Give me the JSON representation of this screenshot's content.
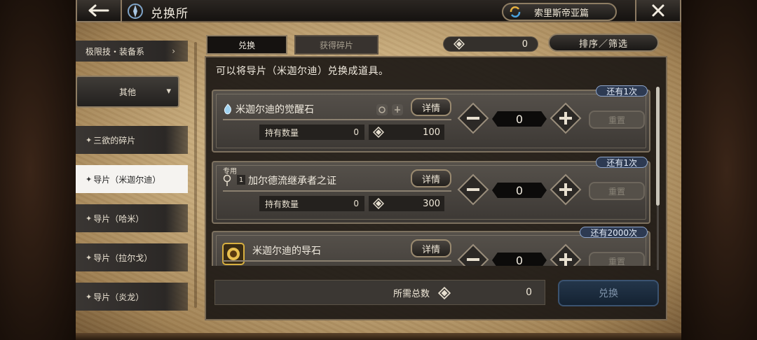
{
  "header": {
    "title": "兑换所",
    "story_button": "索里斯帝亚篇"
  },
  "tabs": {
    "exchange": "兑换",
    "fragments": "获得碎片"
  },
  "currency": {
    "value": "0"
  },
  "sort_filter": "排序／筛选",
  "description": "可以将导片（米迦尔迪）兑换成道具。",
  "sidebar": {
    "items": [
      {
        "label": "极限技・装备系",
        "active": false
      },
      {
        "label": "其他",
        "active": false
      },
      {
        "label": "三欲的碎片",
        "active": false
      },
      {
        "label": "导片（米迦尔迪）",
        "active": true
      },
      {
        "label": "导片（哈米）",
        "active": false
      },
      {
        "label": "导片（拉尔戈）",
        "active": false
      },
      {
        "label": "导片（炎龙）",
        "active": false
      }
    ]
  },
  "items": [
    {
      "name": "米迦尔迪的觉醒石",
      "limit": "还有1次",
      "detail": "详情",
      "owned_label": "持有数量",
      "owned": "0",
      "cost": "100",
      "quantity": "0",
      "reset": "重置"
    },
    {
      "name": "加尔德流继承者之证",
      "tag": "专用",
      "badge": "1",
      "limit": "还有1次",
      "detail": "详情",
      "owned_label": "持有数量",
      "owned": "0",
      "cost": "300",
      "quantity": "0",
      "reset": "重置"
    },
    {
      "name": "米迦尔迪的导石",
      "limit": "还有2000次",
      "detail": "详情",
      "quantity": "0",
      "reset": "重置"
    }
  ],
  "footer": {
    "total_label": "所需总数",
    "total_value": "0",
    "exchange_button": "兑换"
  },
  "colors": {
    "parchment": "#c7ab7c",
    "panel": "#1c1815",
    "limit_badge": "#2d3a52",
    "exchange_button": "#1b2c40"
  },
  "icons": [
    "back-arrow-icon",
    "shop-emblem-icon",
    "refresh-icon",
    "close-icon",
    "crystal-currency-icon",
    "minus-icon",
    "plus-icon",
    "chevron-down-icon",
    "chevron-right-icon"
  ]
}
